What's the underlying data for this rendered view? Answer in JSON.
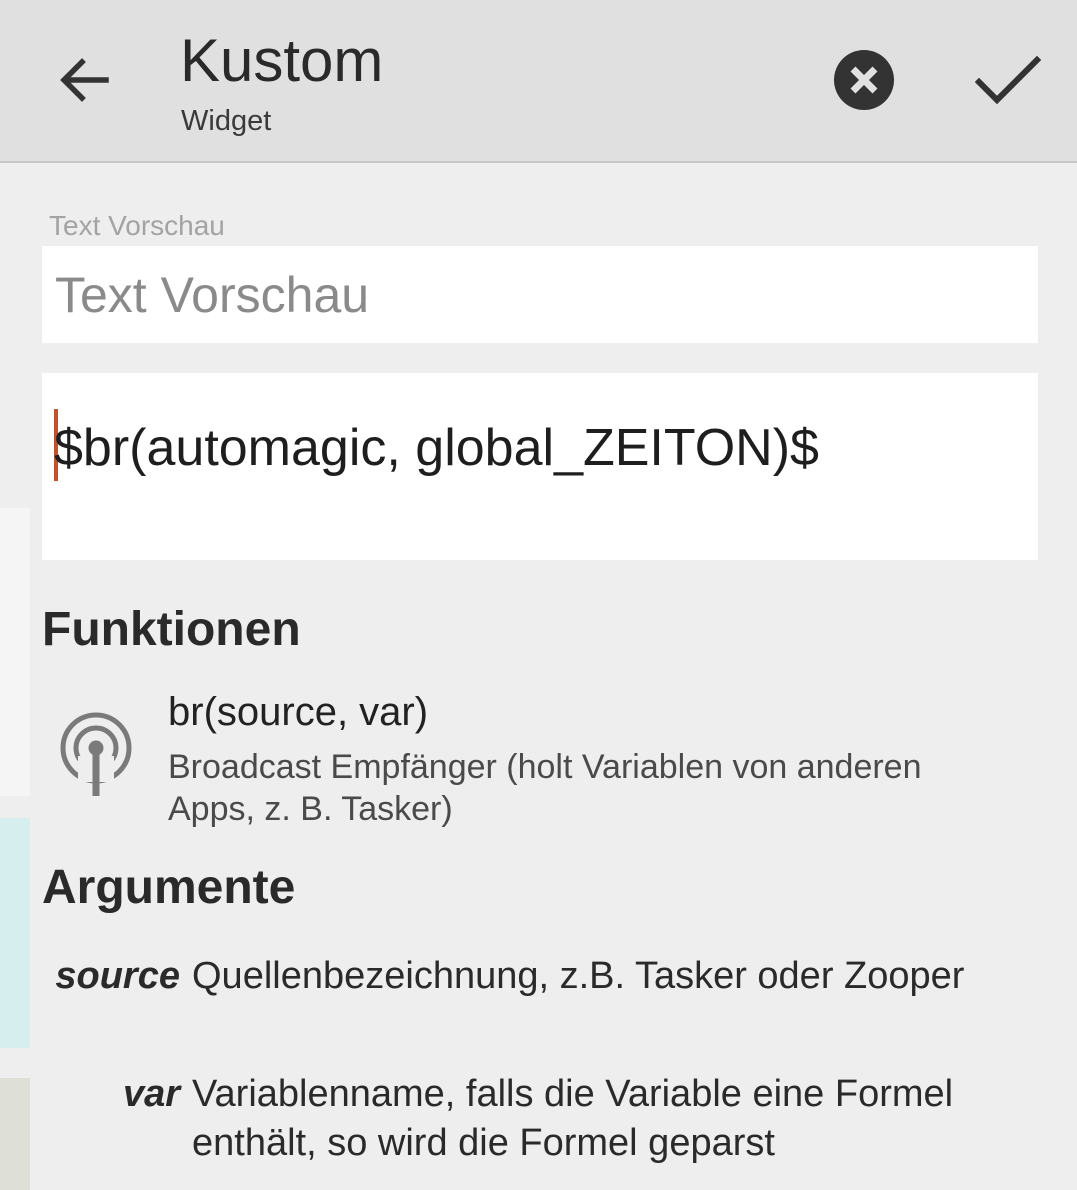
{
  "appbar": {
    "title": "Kustom",
    "subtitle": "Widget",
    "back_icon": "arrow-back-icon",
    "clear_icon": "close-circle-icon",
    "confirm_icon": "checkmark-icon"
  },
  "preview": {
    "label": "Text Vorschau",
    "value": "Text Vorschau"
  },
  "editor": {
    "formula": "$br(automagic, global_ZEITON)$"
  },
  "functions": {
    "heading": "Funktionen",
    "items": [
      {
        "icon": "broadcast-antenna-icon",
        "name": "br(source, var)",
        "description": "Broadcast Empfänger (holt Variablen von anderen Apps, z. B. Tasker)"
      }
    ]
  },
  "arguments": {
    "heading": "Argumente",
    "items": [
      {
        "name": "source",
        "description": "Quellenbezeichnung, z.B. Tasker oder Zooper"
      },
      {
        "name": "var",
        "description": "Variablenname, falls die Variable eine Formel enthält, so wird die Formel geparst"
      }
    ]
  },
  "colors": {
    "appbar_bg": "#e0e0e0",
    "page_bg": "#eeeeee",
    "cursor": "#c0532a",
    "icon_dark": "#333333"
  }
}
